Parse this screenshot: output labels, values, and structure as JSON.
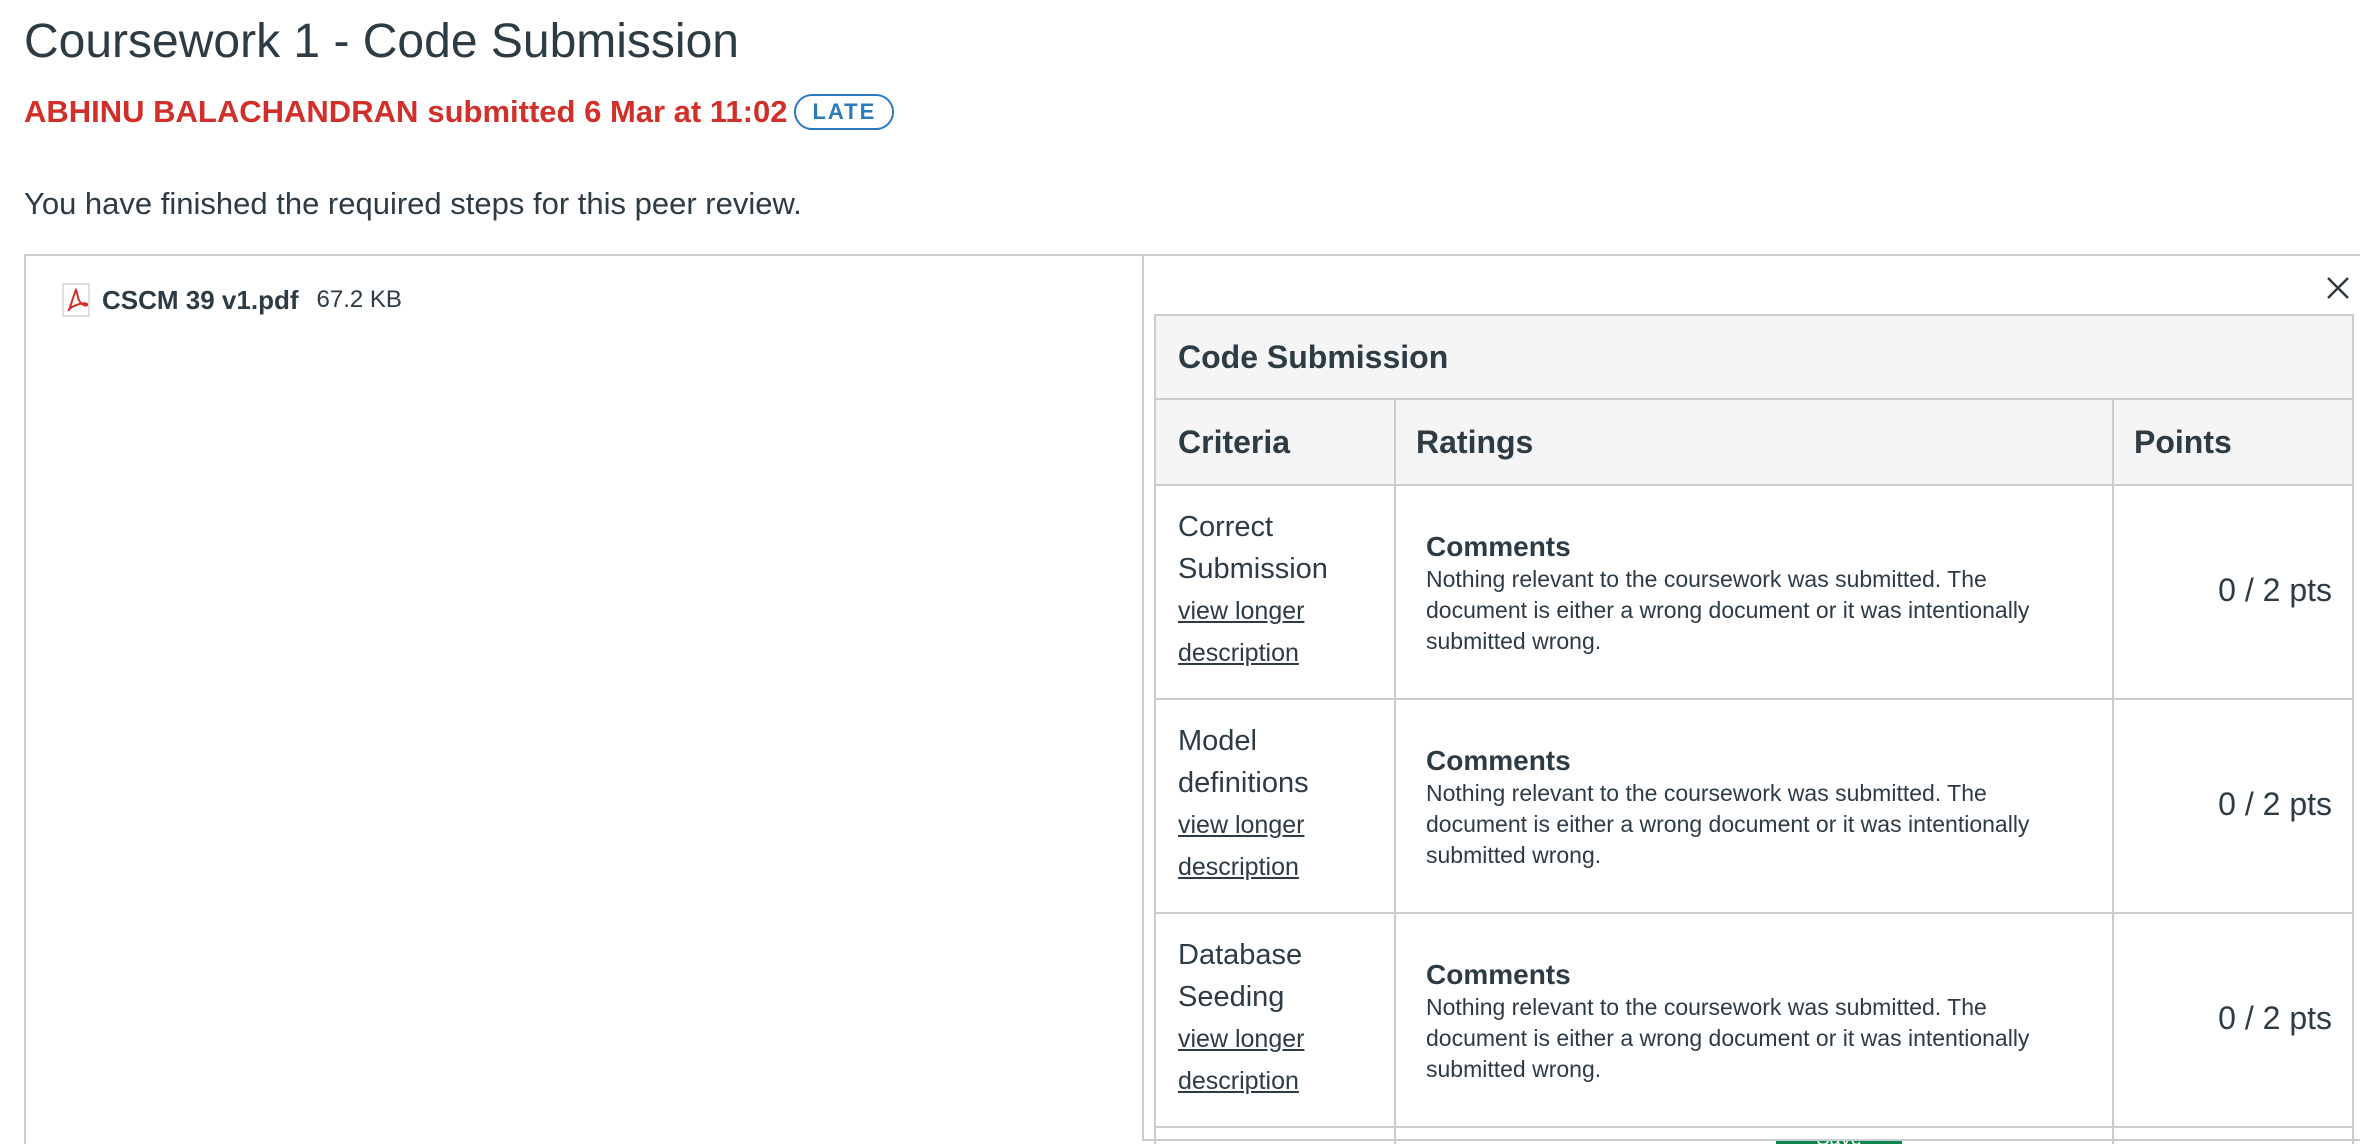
{
  "page": {
    "title": "Coursework 1 - Code Submission",
    "submitter": "ABHINU BALACHANDRAN",
    "submitted_text": "submitted 6 Mar at 11:02",
    "late_badge": "LATE",
    "status_message": "You have finished the required steps for this peer review."
  },
  "file": {
    "name": "CSCM 39 v1.pdf",
    "size": "67.2 KB",
    "icon": "pdf-file-icon"
  },
  "rubric": {
    "title": "Code Submission",
    "close_icon": "close-icon",
    "columns": {
      "criteria": "Criteria",
      "ratings": "Ratings",
      "points": "Points"
    },
    "criteria": [
      {
        "name_line1": "Correct",
        "name_line2": "Submission",
        "link_line1": "view longer",
        "link_line2": "description",
        "rating_title": "Comments",
        "rating_description": "Nothing relevant to the coursework was submitted. The document is either a wrong document or it was intentionally submitted wrong.",
        "points": "0 / 2 pts"
      },
      {
        "name_line1": "Model",
        "name_line2": "definitions",
        "link_line1": "view longer",
        "link_line2": "description",
        "rating_title": "Comments",
        "rating_description": "Nothing relevant to the coursework was submitted. The document is either a wrong document or it was intentionally submitted wrong.",
        "points": "0 / 2 pts"
      },
      {
        "name_line1": "Database",
        "name_line2": "Seeding",
        "link_line1": "view longer",
        "link_line2": "description",
        "rating_title": "Comments",
        "rating_description": "Nothing relevant to the coursework was submitted. The document is either a wrong document or it was intentionally submitted wrong.",
        "points": "0 / 2 pts"
      }
    ]
  },
  "footer": {
    "save_label": "Save"
  },
  "colors": {
    "late_text": "#d12f2a",
    "badge": "#2b7abc",
    "text": "#2d3b45",
    "border": "#c7cdd1",
    "header_bg": "#f5f5f5",
    "save_button": "#0b874b"
  }
}
